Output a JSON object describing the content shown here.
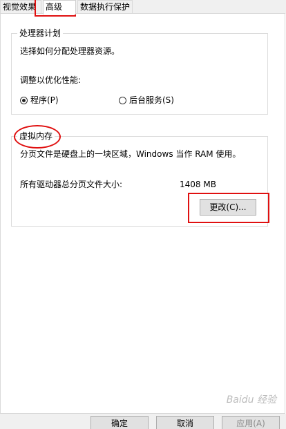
{
  "tabs": [
    {
      "label": "视觉效果",
      "active": false
    },
    {
      "label": "高级",
      "active": true
    },
    {
      "label": "数据执行保护",
      "active": false
    }
  ],
  "processor": {
    "title": "处理器计划",
    "description": "选择如何分配处理器资源。",
    "adjust_label": "调整以优化性能:",
    "option_programs": "程序(P)",
    "option_background": "后台服务(S)"
  },
  "virtual_memory": {
    "title": "虚拟内存",
    "description": "分页文件是硬盘上的一块区域，Windows 当作 RAM 使用。",
    "total_label": "所有驱动器总分页文件大小:",
    "total_value": "1408 MB",
    "change_button": "更改(C)..."
  },
  "footer": {
    "ok": "确定",
    "cancel": "取消",
    "apply": "应用(A)"
  },
  "watermark": "Baidu 经验",
  "colors": {
    "annotation": "#e01010",
    "button_bg": "#e1e1e1",
    "button_border": "#adadad"
  }
}
